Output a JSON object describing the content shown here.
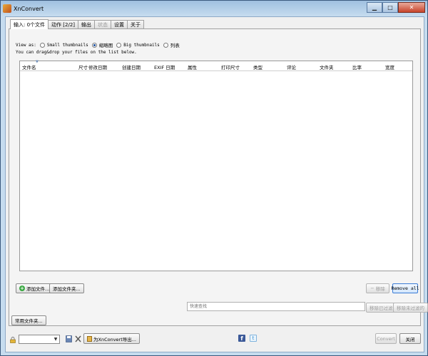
{
  "window": {
    "title": "XnConvert"
  },
  "tabs": [
    {
      "label": "输入: 0个文件",
      "active": true
    },
    {
      "label": "动作 [2/2]",
      "active": false
    },
    {
      "label": "输出",
      "active": false
    },
    {
      "label": "状态",
      "disabled": true
    },
    {
      "label": "设置",
      "active": false
    },
    {
      "label": "关于",
      "active": false
    }
  ],
  "view": {
    "label": "View as:",
    "options": [
      {
        "label": "Small thumbnails",
        "selected": false
      },
      {
        "label": "缩略图",
        "selected": true
      },
      {
        "label": "Big thumbnails",
        "selected": false
      },
      {
        "label": "列表",
        "selected": false
      }
    ],
    "hint": "You can drag&drop your files on the list below."
  },
  "file_list": {
    "columns": [
      "文件名",
      "尺寸",
      "修改日期",
      "创建日期",
      "EXIF 日期",
      "属性",
      "打印尺寸",
      "类型",
      "评论",
      "文件夹",
      "比率",
      "宽度"
    ],
    "rows": []
  },
  "buttons": {
    "add_files": "添加文件...",
    "add_folder": "添加文件夹...",
    "remove": "移除",
    "remove_all": "Remove all",
    "remove_filtered": "移除已过滤的",
    "remove_unfiltered": "移除未过滤的",
    "common_folders": "常用文件夹...",
    "export_xnconvert": "为XnConvert导出...",
    "convert": "Convert",
    "close": "关闭"
  },
  "search": {
    "placeholder": "快速查找"
  },
  "preset": {
    "value": ""
  }
}
